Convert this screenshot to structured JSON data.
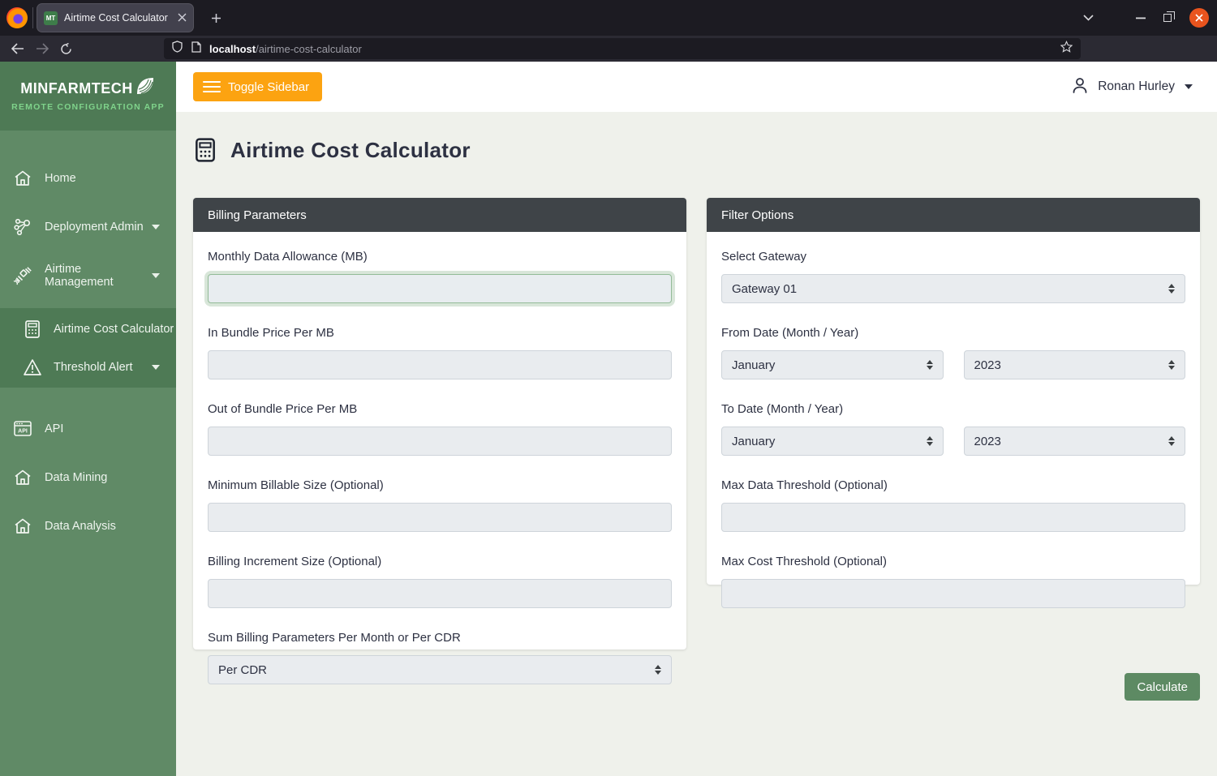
{
  "browser": {
    "tab_title": "Airtime Cost Calculator",
    "favicon_label": "MT",
    "url_host": "localhost",
    "url_path": "/airtime-cost-calculator"
  },
  "sidebar": {
    "logo": {
      "brand_light": "MINFARM",
      "brand_bold": "TECH",
      "subtitle": "REMOTE CONFIGURATION APP"
    },
    "items": [
      {
        "label": "Home"
      },
      {
        "label": "Deployment Admin"
      },
      {
        "label": "Airtime Management"
      }
    ],
    "submenu": [
      {
        "label": "Airtime Cost Calculator"
      },
      {
        "label": "Threshold Alert"
      }
    ],
    "items_bottom": [
      {
        "label": "API"
      },
      {
        "label": "Data Mining"
      },
      {
        "label": "Data Analysis"
      }
    ]
  },
  "header": {
    "toggle_label": "Toggle Sidebar",
    "user_name": "Ronan Hurley"
  },
  "page": {
    "title": "Airtime Cost Calculator"
  },
  "billing": {
    "title": "Billing Parameters",
    "fields": [
      {
        "label": "Monthly Data Allowance (MB)",
        "value": ""
      },
      {
        "label": "In Bundle Price Per MB",
        "value": ""
      },
      {
        "label": "Out of Bundle Price Per MB",
        "value": ""
      },
      {
        "label": "Minimum Billable Size (Optional)",
        "value": ""
      },
      {
        "label": "Billing Increment Size (Optional)",
        "value": ""
      }
    ],
    "sum_mode": {
      "label": "Sum Billing Parameters Per Month or Per CDR",
      "value": "Per CDR"
    }
  },
  "filter": {
    "title": "Filter Options",
    "gateway": {
      "label": "Select Gateway",
      "value": "Gateway 01"
    },
    "from_date": {
      "label": "From Date (Month / Year)",
      "month": "January",
      "year": "2023"
    },
    "to_date": {
      "label": "To Date (Month / Year)",
      "month": "January",
      "year": "2023"
    },
    "max_data": {
      "label": "Max Data Threshold (Optional)",
      "value": ""
    },
    "max_cost": {
      "label": "Max Cost Threshold (Optional)",
      "value": ""
    }
  },
  "actions": {
    "calculate_label": "Calculate"
  },
  "colors": {
    "accent_orange": "#fca311",
    "sidebar_green": "#608a66",
    "sidebar_dark_green": "#4e7a55",
    "card_header": "#3f4448",
    "button_green": "#5d8a63",
    "window_close": "#e9541e",
    "content_bg": "#eff1eb"
  }
}
